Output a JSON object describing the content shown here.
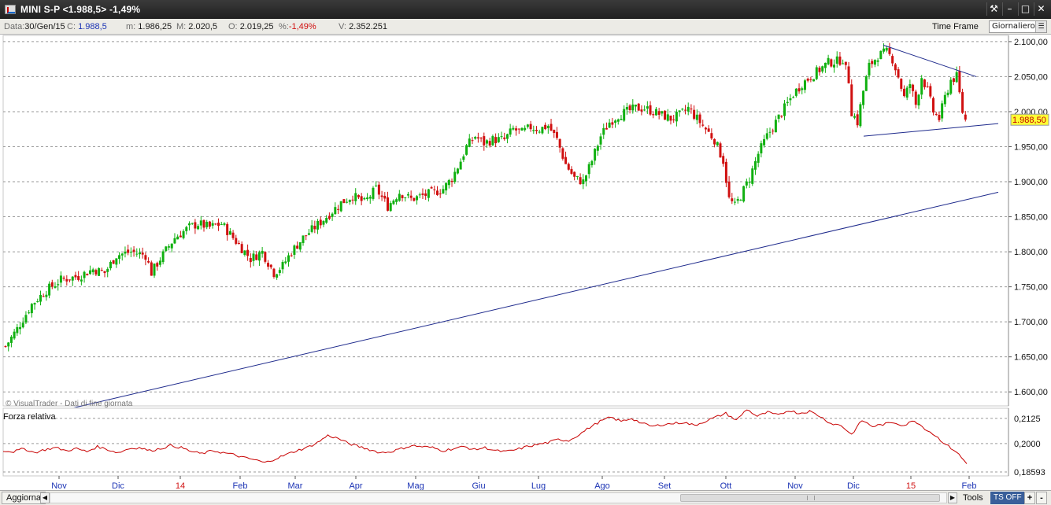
{
  "window": {
    "title": "MINI S-P <1.988,5> -1,49%",
    "buttons": [
      "tools-icon",
      "minimize-icon",
      "maximize-icon",
      "close-icon"
    ]
  },
  "infobar": {
    "data_label": "Data:",
    "data_value": "30/Gen/15",
    "c_label": "C:",
    "c_value": "1.988,5",
    "m_label": "m:",
    "m_value": "1.986,25",
    "M_label": "M:",
    "M_value": "2.020,5",
    "o_label": "O:",
    "o_value": "2.019,25",
    "pct_label": "%:",
    "pct_value": "-1,49%",
    "v_label": "V:",
    "v_value": "2.352.251",
    "timeframe_label": "Time Frame",
    "timeframe_value": "Giornaliero"
  },
  "chart_data": [
    {
      "type": "candlestick",
      "ylim": [
        1580,
        2110
      ],
      "yticks": [
        "1.600,00",
        "1.650,00",
        "1.700,00",
        "1.750,00",
        "1.800,00",
        "1.850,00",
        "1.900,00",
        "1.950,00",
        "2.000,00",
        "2.050,00",
        "2.100,00"
      ],
      "ytick_values": [
        1600,
        1650,
        1700,
        1750,
        1800,
        1850,
        1900,
        1950,
        2000,
        2050,
        2100
      ],
      "current_price_label": "1.988,50",
      "current_price": 1988.5,
      "watermark": "© VisualTrader - Dati di fine giornata",
      "months": [
        "Nov",
        "Dic",
        "14",
        "Feb",
        "Mar",
        "Apr",
        "Mag",
        "Giu",
        "Lug",
        "Ago",
        "Set",
        "Ott",
        "Nov",
        "Dic",
        "15",
        "Feb"
      ],
      "month_highlight": [
        false,
        false,
        true,
        false,
        false,
        false,
        false,
        false,
        false,
        false,
        false,
        false,
        false,
        false,
        true,
        false
      ],
      "close_path": [
        [
          0,
          1665
        ],
        [
          4,
          1690
        ],
        [
          9,
          1725
        ],
        [
          14,
          1745
        ],
        [
          19,
          1760
        ],
        [
          25,
          1765
        ],
        [
          30,
          1775
        ],
        [
          34,
          1770
        ],
        [
          38,
          1795
        ],
        [
          43,
          1800
        ],
        [
          48,
          1795
        ],
        [
          50,
          1770
        ],
        [
          53,
          1790
        ],
        [
          58,
          1820
        ],
        [
          63,
          1835
        ],
        [
          66,
          1840
        ],
        [
          70,
          1835
        ],
        [
          74,
          1840
        ],
        [
          77,
          1825
        ],
        [
          80,
          1810
        ],
        [
          84,
          1790
        ],
        [
          88,
          1800
        ],
        [
          92,
          1770
        ],
        [
          95,
          1780
        ],
        [
          98,
          1800
        ],
        [
          102,
          1820
        ],
        [
          106,
          1835
        ],
        [
          110,
          1850
        ],
        [
          115,
          1870
        ],
        [
          119,
          1880
        ],
        [
          123,
          1870
        ],
        [
          127,
          1890
        ],
        [
          131,
          1865
        ],
        [
          135,
          1885
        ],
        [
          139,
          1875
        ],
        [
          143,
          1880
        ],
        [
          147,
          1885
        ],
        [
          150,
          1890
        ],
        [
          153,
          1905
        ],
        [
          156,
          1930
        ],
        [
          158,
          1950
        ],
        [
          161,
          1965
        ],
        [
          164,
          1955
        ],
        [
          167,
          1960
        ],
        [
          171,
          1960
        ],
        [
          174,
          1975
        ],
        [
          177,
          1970
        ],
        [
          180,
          1978
        ],
        [
          183,
          1975
        ],
        [
          186,
          1980
        ],
        [
          189,
          1960
        ],
        [
          192,
          1925
        ],
        [
          195,
          1905
        ],
        [
          198,
          1900
        ],
        [
          201,
          1930
        ],
        [
          204,
          1965
        ],
        [
          207,
          1985
        ],
        [
          210,
          1995
        ],
        [
          213,
          2000
        ],
        [
          216,
          2005
        ],
        [
          219,
          2005
        ],
        [
          222,
          2000
        ],
        [
          225,
          1995
        ],
        [
          228,
          1990
        ],
        [
          231,
          1995
        ],
        [
          234,
          2005
        ],
        [
          237,
          1990
        ],
        [
          240,
          1975
        ],
        [
          243,
          1960
        ],
        [
          246,
          1930
        ],
        [
          248,
          1875
        ],
        [
          250,
          1865
        ],
        [
          252,
          1880
        ],
        [
          255,
          1905
        ],
        [
          258,
          1940
        ],
        [
          261,
          1965
        ],
        [
          264,
          1985
        ],
        [
          267,
          2005
        ],
        [
          270,
          2025
        ],
        [
          273,
          2040
        ],
        [
          276,
          2050
        ],
        [
          279,
          2060
        ],
        [
          282,
          2070
        ],
        [
          285,
          2072
        ],
        [
          287,
          2075
        ],
        [
          289,
          2045
        ],
        [
          290,
          2000
        ],
        [
          292,
          1985
        ],
        [
          294,
          2030
        ],
        [
          296,
          2065
        ],
        [
          299,
          2080
        ],
        [
          302,
          2085
        ],
        [
          304,
          2075
        ],
        [
          306,
          2050
        ],
        [
          308,
          2020
        ],
        [
          310,
          2040
        ],
        [
          312,
          2010
        ],
        [
          314,
          2050
        ],
        [
          316,
          2030
        ],
        [
          318,
          2000
        ],
        [
          320,
          1990
        ],
        [
          322,
          2020
        ],
        [
          324,
          2045
        ],
        [
          326,
          2050
        ],
        [
          327,
          2025
        ],
        [
          328,
          2000
        ],
        [
          329,
          1988
        ]
      ],
      "trendlines": [
        {
          "from": [
            1575,
            22
          ],
          "to": [
            1885,
            339
          ]
        },
        {
          "from": [
            2095,
            300
          ],
          "to": [
            2050,
            339
          ]
        },
        {
          "from": [
            1965,
            297
          ],
          "to": [
            1983,
            339
          ]
        }
      ]
    },
    {
      "type": "line",
      "title": "Forza relativa",
      "ylim": [
        0.184,
        0.2175
      ],
      "yticks": [
        "0,2125",
        "0,2000",
        "0,18593"
      ],
      "ytick_values": [
        0.2125,
        0.2,
        0.18593
      ],
      "series": [
        {
          "values": [
            0.1965,
            0.196,
            0.1975,
            0.1955,
            0.197,
            0.198,
            0.1965,
            0.1975,
            0.196,
            0.1985,
            0.197,
            0.1955,
            0.1975,
            0.198,
            0.1965,
            0.1975,
            0.199,
            0.198,
            0.196,
            0.195,
            0.1965,
            0.1955,
            0.1945,
            0.193,
            0.192,
            0.1905,
            0.1925,
            0.1945,
            0.1965,
            0.198,
            0.2005,
            0.204,
            0.2025,
            0.2,
            0.1985,
            0.197,
            0.1955,
            0.196,
            0.1975,
            0.199,
            0.1985,
            0.198,
            0.1965,
            0.1975,
            0.1985,
            0.197,
            0.198,
            0.1965,
            0.196,
            0.197,
            0.1985,
            0.1995,
            0.2005,
            0.202,
            0.2015,
            0.2045,
            0.208,
            0.211,
            0.213,
            0.211,
            0.2125,
            0.21,
            0.2085,
            0.2095,
            0.21,
            0.2105,
            0.209,
            0.211,
            0.213,
            0.215,
            0.2115,
            0.217,
            0.2135,
            0.2155,
            0.214,
            0.2165,
            0.215,
            0.216,
            0.2135,
            0.21,
            0.209,
            0.2045,
            0.2115,
            0.2085,
            0.2095,
            0.2105,
            0.209,
            0.2115,
            0.2075,
            0.204,
            0.1995,
            0.196,
            0.19
          ]
        }
      ]
    }
  ]
}
